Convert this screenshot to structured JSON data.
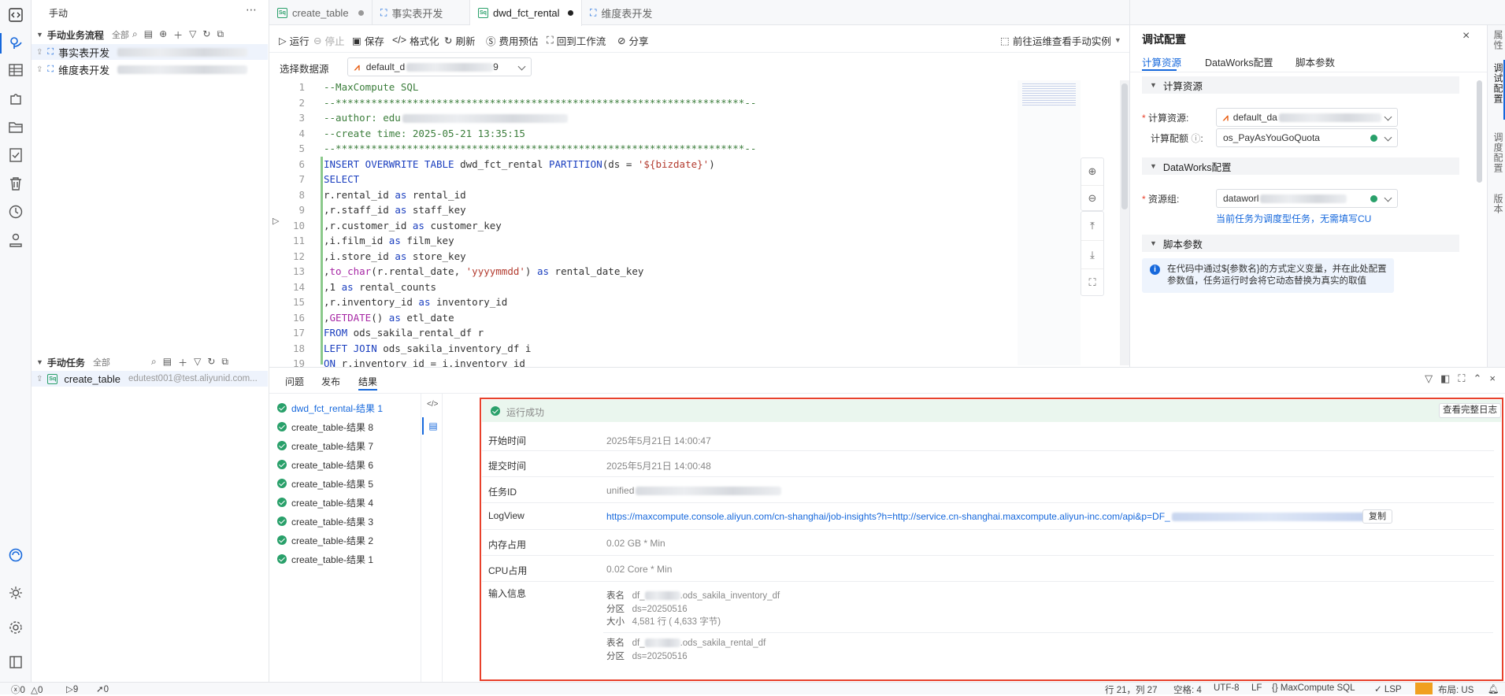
{
  "explorer": {
    "section_title": "手动",
    "business_flow": {
      "title": "手动业务流程",
      "filter": "全部",
      "items": [
        {
          "label": "事实表开发"
        },
        {
          "label": "维度表开发"
        }
      ]
    },
    "manual_tasks": {
      "title": "手动任务",
      "filter": "全部",
      "items": [
        {
          "label": "create_table",
          "owner": "edutest001@test.aliyunid.com..."
        }
      ]
    }
  },
  "tabs": [
    {
      "label": "create_table",
      "type": "sql",
      "modified": true
    },
    {
      "label": "事实表开发",
      "type": "flow"
    },
    {
      "label": "dwd_fct_rental",
      "type": "sql",
      "modified": true,
      "active": true
    },
    {
      "label": "维度表开发",
      "type": "flow"
    }
  ],
  "toolbar": {
    "run": "运行",
    "stop": "停止",
    "save": "保存",
    "format": "格式化",
    "refresh": "刷新",
    "cost": "费用预估",
    "back_to_flow": "回到工作流",
    "share": "分享",
    "ops_link": "前往运维查看手动实例"
  },
  "datasource": {
    "label": "选择数据源",
    "value": "default_d",
    "value_suffix": "9"
  },
  "editor": {
    "lines": [
      {
        "n": "1",
        "t": [
          [
            "cm",
            "--MaxCompute SQL"
          ]
        ]
      },
      {
        "n": "2",
        "t": [
          [
            "cm",
            "--*********************************************************************--"
          ]
        ]
      },
      {
        "n": "3",
        "t": [
          [
            "cm",
            "--author: edu"
          ]
        ]
      },
      {
        "n": "4",
        "t": [
          [
            "cm",
            "--create time: 2025-05-21 13:35:15"
          ]
        ]
      },
      {
        "n": "5",
        "t": [
          [
            "cm",
            "--*********************************************************************--"
          ]
        ]
      },
      {
        "n": "6",
        "t": [
          [
            "kw",
            "INSERT OVERWRITE TABLE "
          ],
          [
            "",
            "dwd_fct_rental "
          ],
          [
            "kw",
            "PARTITION"
          ],
          [
            "",
            "(ds = "
          ],
          [
            "str",
            "'${bizdate}'"
          ],
          [
            "",
            ")"
          ]
        ]
      },
      {
        "n": "7",
        "t": [
          [
            "kw",
            "SELECT"
          ]
        ]
      },
      {
        "n": "8",
        "t": [
          [
            "",
            "r.rental_id "
          ],
          [
            "kw",
            "as"
          ],
          [
            "",
            " rental_id"
          ]
        ]
      },
      {
        "n": "9",
        "t": [
          [
            "",
            ",r.staff_id "
          ],
          [
            "kw",
            "as"
          ],
          [
            "",
            " staff_key"
          ]
        ]
      },
      {
        "n": "10",
        "t": [
          [
            "",
            ",r.customer_id "
          ],
          [
            "kw",
            "as"
          ],
          [
            "",
            " customer_key"
          ]
        ]
      },
      {
        "n": "11",
        "t": [
          [
            "",
            ",i.film_id "
          ],
          [
            "kw",
            "as"
          ],
          [
            "",
            " film_key"
          ]
        ]
      },
      {
        "n": "12",
        "t": [
          [
            "",
            ",i.store_id "
          ],
          [
            "kw",
            "as"
          ],
          [
            "",
            " store_key"
          ]
        ]
      },
      {
        "n": "13",
        "t": [
          [
            "",
            ","
          ],
          [
            "fn",
            "to_char"
          ],
          [
            "",
            "(r.rental_date, "
          ],
          [
            "str",
            "'yyyymmdd'"
          ],
          [
            "",
            ") "
          ],
          [
            "kw",
            "as"
          ],
          [
            "",
            " rental_date_key"
          ]
        ]
      },
      {
        "n": "14",
        "t": [
          [
            "",
            ",1 "
          ],
          [
            "kw",
            "as"
          ],
          [
            "",
            " rental_counts"
          ]
        ]
      },
      {
        "n": "15",
        "t": [
          [
            "",
            ",r.inventory_id "
          ],
          [
            "kw",
            "as"
          ],
          [
            "",
            " inventory_id"
          ]
        ]
      },
      {
        "n": "16",
        "t": [
          [
            "",
            ","
          ],
          [
            "fn",
            "GETDATE"
          ],
          [
            "",
            "() "
          ],
          [
            "kw",
            "as"
          ],
          [
            "",
            " etl_date"
          ]
        ]
      },
      {
        "n": "17",
        "t": [
          [
            "kw",
            "FROM"
          ],
          [
            "",
            " ods_sakila_rental_df r"
          ]
        ]
      },
      {
        "n": "18",
        "t": [
          [
            "kw",
            "LEFT JOIN"
          ],
          [
            "",
            " ods_sakila_inventory_df i"
          ]
        ]
      },
      {
        "n": "19",
        "t": [
          [
            "kw",
            "ON"
          ],
          [
            "",
            " r.inventory_id = i.inventory_id"
          ]
        ]
      }
    ]
  },
  "config": {
    "title": "调试配置",
    "tabs": [
      "计算资源",
      "DataWorks配置",
      "脚本参数"
    ],
    "compute_section": "计算资源",
    "compute_resource_label": "计算资源:",
    "compute_resource_value": "default_da",
    "quota_label": "计算配额",
    "quota_value": "os_PayAsYouGoQuota",
    "dw_section": "DataWorks配置",
    "resource_group_label": "资源组:",
    "resource_group_value": "dataworl",
    "cu_hint": "当前任务为调度型任务，无需填写CU",
    "script_section": "脚本参数",
    "script_info": "在代码中通过${参数名}的方式定义变量，并在此处配置参数值，任务运行时会将它动态替换为真实的取值"
  },
  "right_strip": [
    "属性",
    "调试配置",
    "调度配置",
    "版本"
  ],
  "bottom": {
    "tabs": [
      "问题",
      "发布",
      "结果"
    ],
    "results": [
      "dwd_fct_rental-结果 1",
      "create_table-结果 8",
      "create_table-结果 7",
      "create_table-结果 6",
      "create_table-结果 5",
      "create_table-结果 4",
      "create_table-结果 3",
      "create_table-结果 2",
      "create_table-结果 1"
    ],
    "status_text": "运行成功",
    "full_log": "查看完整日志",
    "start_time_label": "开始时间",
    "start_time": "2025年5月21日 14:00:47",
    "submit_time_label": "提交时间",
    "submit_time": "2025年5月21日 14:00:48",
    "task_id_label": "任务ID",
    "task_id": "unified",
    "logview_label": "LogView",
    "logview_url": "https://maxcompute.console.aliyun.com/cn-shanghai/job-insights?h=http://service.cn-shanghai.maxcompute.aliyun-inc.com/api&p=DF_",
    "copy": "复制",
    "memory_label": "内存占用",
    "memory": "0.02 GB * Min",
    "cpu_label": "CPU占用",
    "cpu": "0.02 Core * Min",
    "input_label": "输入信息",
    "inputs": [
      {
        "k1": "表名",
        "v1_prefix": "df_",
        "v1": ".ods_sakila_inventory_df",
        "k2": "分区",
        "v2": "ds=20250516",
        "k3": "大小",
        "v3": "4,581 行 ( 4,633 字节)"
      },
      {
        "k1": "表名",
        "v1_prefix": "df_",
        "v1": ".ods_sakila_rental_df",
        "k2": "分区",
        "v2": "ds=20250516"
      }
    ]
  },
  "status_bar": {
    "errors": "0",
    "warnings": "0",
    "p1": "9",
    "p2": "0",
    "cursor": "行 21，列 27",
    "spaces": "空格: 4",
    "encoding": "UTF-8",
    "eol": "LF",
    "language": "MaxCompute SQL",
    "lsp": "LSP",
    "layout": "布局: US"
  },
  "colors": {
    "accent": "#1668dc",
    "success": "#29a06a",
    "highlight_border": "#e8412c",
    "success_bg": "#eaf6ee"
  }
}
